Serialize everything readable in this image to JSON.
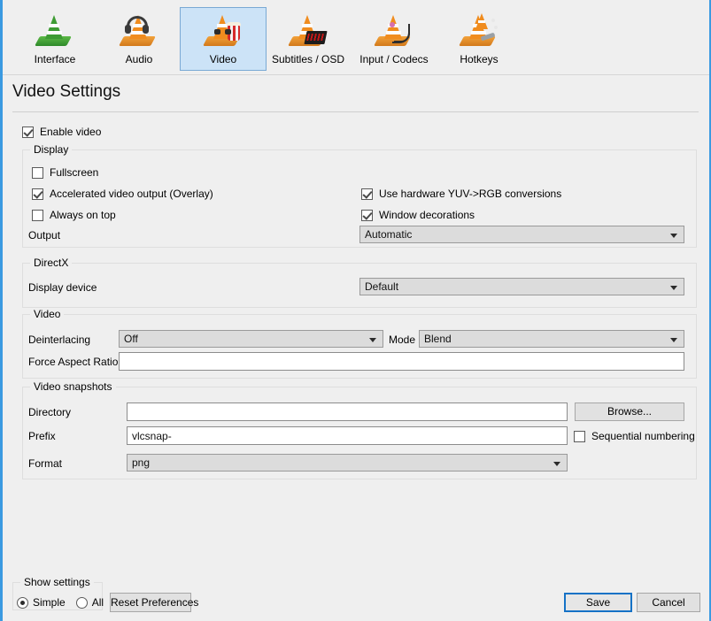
{
  "toolbar": {
    "tabs": [
      {
        "label": "Interface",
        "icon": "vlc-cone-green-icon",
        "selected": false
      },
      {
        "label": "Audio",
        "icon": "vlc-cone-headphones-icon",
        "selected": false
      },
      {
        "label": "Video",
        "icon": "vlc-cone-glasses-popcorn-icon",
        "selected": true
      },
      {
        "label": "Subtitles / OSD",
        "icon": "vlc-cone-osd-icon",
        "selected": false
      },
      {
        "label": "Input / Codecs",
        "icon": "vlc-cone-cables-icon",
        "selected": false
      },
      {
        "label": "Hotkeys",
        "icon": "vlc-cone-wrench-icon",
        "selected": false
      }
    ]
  },
  "page": {
    "title": "Video Settings"
  },
  "enable_video": {
    "label": "Enable video",
    "checked": true
  },
  "display_group": {
    "legend": "Display",
    "fullscreen": {
      "label": "Fullscreen",
      "checked": false
    },
    "accelerated": {
      "label": "Accelerated video output (Overlay)",
      "checked": true
    },
    "always_on_top": {
      "label": "Always on top",
      "checked": false
    },
    "hardware_yuv": {
      "label": "Use hardware YUV->RGB conversions",
      "checked": true
    },
    "window_decorations": {
      "label": "Window decorations",
      "checked": true
    },
    "output": {
      "label": "Output",
      "value": "Automatic"
    }
  },
  "directx_group": {
    "legend": "DirectX",
    "display_device": {
      "label": "Display device",
      "value": "Default"
    }
  },
  "video_group": {
    "legend": "Video",
    "deinterlacing": {
      "label": "Deinterlacing",
      "value": "Off"
    },
    "mode": {
      "label": "Mode",
      "value": "Blend"
    },
    "force_aspect_ratio": {
      "label": "Force Aspect Ratio",
      "value": "",
      "placeholder": ""
    }
  },
  "snapshots_group": {
    "legend": "Video snapshots",
    "directory": {
      "label": "Directory",
      "value": "",
      "placeholder": ""
    },
    "browse_button": "Browse...",
    "prefix": {
      "label": "Prefix",
      "value": "vlcsnap-"
    },
    "sequential_numbering": {
      "label": "Sequential numbering",
      "checked": false
    },
    "format": {
      "label": "Format",
      "value": "png"
    }
  },
  "bottom": {
    "show_settings_legend": "Show settings",
    "simple_label": "Simple",
    "all_label": "All",
    "simple_selected": true,
    "all_selected": false,
    "reset_button": "Reset Preferences",
    "save_button": "Save",
    "cancel_button": "Cancel"
  },
  "colors": {
    "window_border": "#3b9ae1",
    "background": "#efefef",
    "selected_tab_bg": "#cce3f7",
    "selected_tab_border": "#7aa9d4",
    "combo_bg": "#dcdcdc",
    "default_button_border": "#1572c6",
    "cone_orange": "#f08c1e",
    "cone_green": "#3d9b33"
  }
}
